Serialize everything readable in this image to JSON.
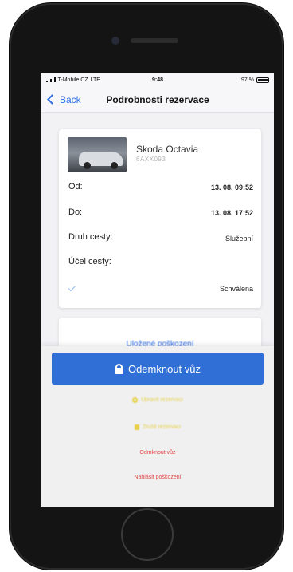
{
  "status_bar": {
    "carrier": "T-Mobile CZ",
    "network": "LTE",
    "time": "9:48",
    "battery": "97 %"
  },
  "nav": {
    "back_label": "Back",
    "title": "Podrobnosti rezervace"
  },
  "reservation": {
    "car_name": "Skoda Octavia",
    "car_plate": "6AXX093",
    "from_label": "Od:",
    "from_value": "13. 08. 09:52",
    "to_label": "Do:",
    "to_value": "13. 08. 17:52",
    "trip_type_label": "Druh cesty:",
    "trip_type_value": "Služební",
    "purpose_label": "Účel cesty:",
    "purpose_value": "",
    "status_value": "Schválena"
  },
  "second_card": {
    "text": "Uložené poškození"
  },
  "actions": {
    "unlock_label": "Odemknout vůz",
    "edit_label": "Upravit rezervaci",
    "delete_label": "Zrušit rezervaci",
    "lock_label": "Odmknout vůz",
    "report_damage_label": "Nahlásit poškození"
  },
  "colors": {
    "accent": "#2f6fd6",
    "link": "#2f6ee5",
    "warning": "#e7d24a",
    "danger": "#e24a4a"
  }
}
